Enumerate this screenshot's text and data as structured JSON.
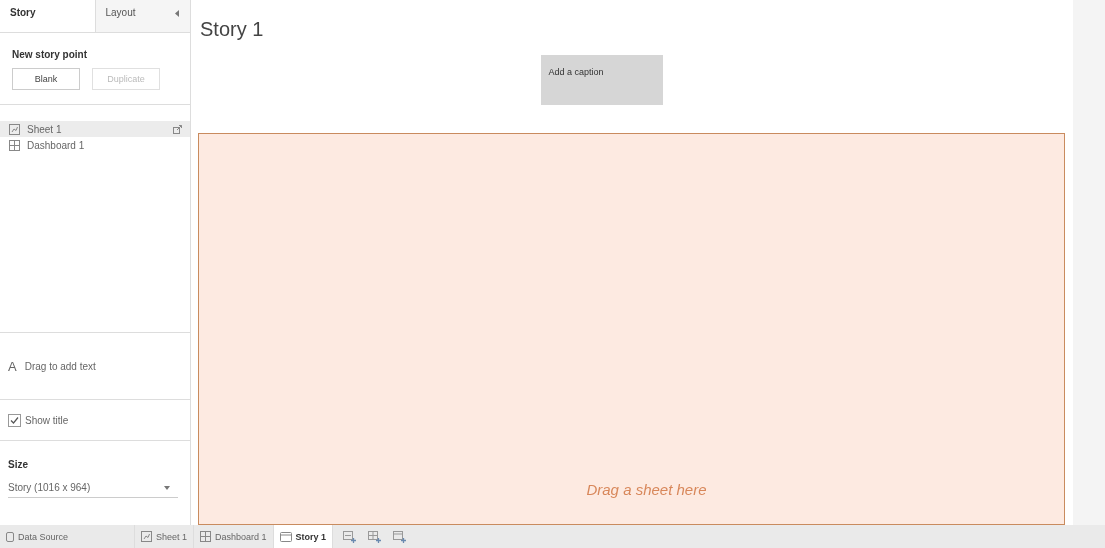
{
  "sidebar": {
    "tabs": [
      {
        "label": "Story",
        "selected": true
      },
      {
        "label": "Layout",
        "selected": false
      }
    ],
    "new_story_point": {
      "heading": "New story point",
      "buttons": [
        {
          "label": "Blank",
          "disabled": false
        },
        {
          "label": "Duplicate",
          "disabled": true
        }
      ]
    },
    "sheets": [
      {
        "label": "Sheet 1",
        "kind": "sheet",
        "selected": true
      },
      {
        "label": "Dashboard 1",
        "kind": "dashboard",
        "selected": false
      }
    ],
    "text_object": {
      "glyph": "A",
      "label": "Drag to add text"
    },
    "show_title": {
      "label": "Show title",
      "checked": true
    },
    "size": {
      "heading": "Size",
      "value": "Story (1016 x 964)"
    }
  },
  "story": {
    "title": "Story 1",
    "caption": "Add a caption",
    "drop_hint": "Drag a sheet here"
  },
  "bottom_tabs": [
    {
      "label": "Data Source",
      "kind": "datasource",
      "selected": false
    },
    {
      "label": "Sheet 1",
      "kind": "sheet",
      "selected": false
    },
    {
      "label": "Dashboard 1",
      "kind": "dashboard",
      "selected": false
    },
    {
      "label": "Story 1",
      "kind": "story",
      "selected": true
    }
  ]
}
